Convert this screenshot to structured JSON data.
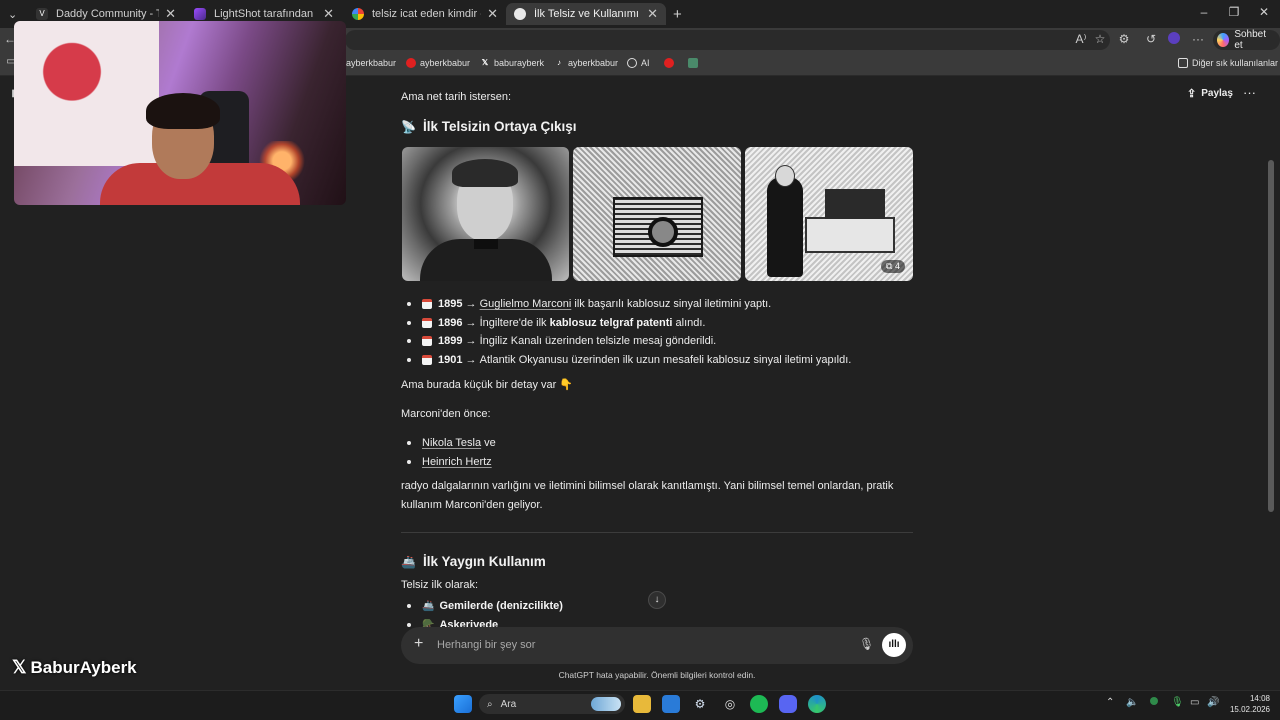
{
  "browser": {
    "tabs": [
      {
        "title": "Daddy Community - Türkiye'nin En",
        "favicon": "daddy-community-icon"
      },
      {
        "title": "LightShot tarafından Ekran Görüntü",
        "favicon": "lightshot-icon"
      },
      {
        "title": "telsiz icat eden kimdir - Google'da",
        "favicon": "google-icon"
      },
      {
        "title": "İlk Telsiz ve Kullanımı",
        "favicon": "chatgpt-icon",
        "active": true
      }
    ],
    "new_tab": "+",
    "window_controls": {
      "minimize": "–",
      "restore": "❐",
      "close": "✕"
    },
    "chat_button": "Sohbet et",
    "bookmarks": [
      {
        "label": "ayberkbabur",
        "icon": "youtube-icon"
      },
      {
        "label": "ayberkbabur",
        "icon": "youtube-icon"
      },
      {
        "label": "baburayberk",
        "icon": "x-icon"
      },
      {
        "label": "ayberkbabur",
        "icon": "tiktok-icon"
      },
      {
        "label": "AI",
        "icon": "chatgpt-icon"
      },
      {
        "label": "",
        "icon": "youtube-icon"
      },
      {
        "label": "",
        "icon": "image-icon"
      }
    ],
    "other_bookmarks": "Diğer sık kullanılanlar"
  },
  "header": {
    "share": "Paylaş",
    "more": "···"
  },
  "content": {
    "intro": "Ama net tarih istersen:",
    "section1": {
      "emoji": "📡",
      "title": "İlk Telsizin Ortaya Çıkışı",
      "images_extra_count": "4",
      "timeline": [
        {
          "year": "1895",
          "arrow": "→",
          "link": "Guglielmo Marconi",
          "text": "ilk başarılı kablosuz sinyal iletimini yaptı."
        },
        {
          "year": "1896",
          "arrow": "→",
          "pre": "İngiltere'de ilk",
          "bold": "kablosuz telgraf patenti",
          "post": "alındı."
        },
        {
          "year": "1899",
          "arrow": "→",
          "text": "İngiliz Kanalı üzerinden telsizle mesaj gönderildi."
        },
        {
          "year": "1901",
          "arrow": "→",
          "text": "Atlantik Okyanusu üzerinden ilk uzun mesafeli kablosuz sinyal iletimi yapıldı."
        }
      ],
      "detail": "Ama burada küçük bir detay var",
      "detail_emoji": "👇",
      "before": "Marconi'den önce:",
      "names": [
        {
          "link": "Nikola Tesla",
          "suffix": "ve"
        },
        {
          "link": "Heinrich Hertz",
          "suffix": ""
        }
      ],
      "para_line1": "radyo dalgalarının varlığını ve iletimini bilimsel olarak kanıtlamıştı. Yani bilimsel temel onlardan, pratik",
      "para_line2": "kullanım Marconi'den geliyor."
    },
    "section2": {
      "emoji": "🚢",
      "title": "İlk Yaygın Kullanım",
      "intro": "Telsiz ilk olarak:",
      "items": [
        {
          "emoji": "🚢",
          "label": "Gemilerde (denizcilikte)"
        },
        {
          "emoji": "🪖",
          "label": "Askeriyede"
        }
      ]
    }
  },
  "composer": {
    "placeholder": "Herhangi bir şey sor",
    "disclaimer": "ChatGPT hata yapabilir. Önemli bilgileri kontrol edin."
  },
  "watermark": "BaburAyberk",
  "taskbar": {
    "search": "Ara",
    "time": "14:08",
    "date": "15.02.2026"
  },
  "colors": {
    "page_bg": "#212121",
    "composer_bg": "#303030",
    "tab_active": "#3a3a3a",
    "calendar_red": "#d84a3a"
  }
}
